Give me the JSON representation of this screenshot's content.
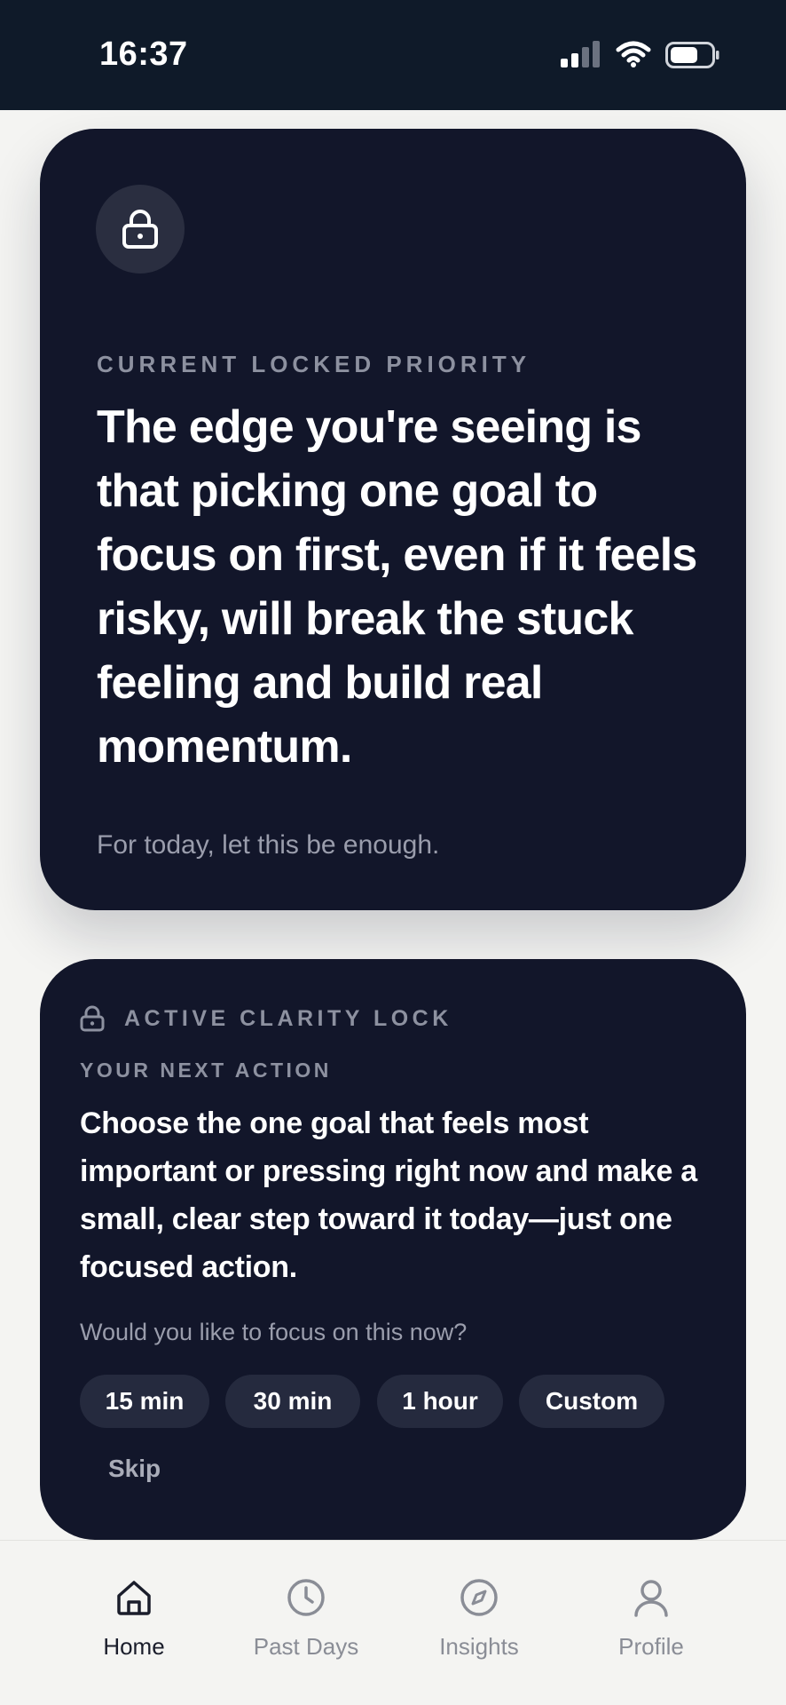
{
  "status_bar": {
    "time": "16:37",
    "icons": [
      "signal-icon",
      "wifi-icon",
      "battery-icon"
    ]
  },
  "priority_card": {
    "icon": "lock-icon",
    "label": "CURRENT LOCKED PRIORITY",
    "text": "The edge you're seeing is that picking one goal to focus on first, even if it feels risky, will break the stuck feeling and build real momentum.",
    "subtext": "For today, let this be enough."
  },
  "action_card": {
    "icon": "lock-icon",
    "active_label": "ACTIVE CLARITY LOCK",
    "next_label": "YOUR NEXT ACTION",
    "next_text": "Choose the one goal that feels most important or pressing right now and make a small, clear step toward it today—just one focused action.",
    "question": "Would you like to focus on this now?",
    "options": [
      "15 min",
      "30 min",
      "1 hour",
      "Custom"
    ],
    "skip": "Skip"
  },
  "tab_bar": {
    "items": [
      {
        "label": "Home",
        "icon": "home-icon",
        "active": true
      },
      {
        "label": "Past Days",
        "icon": "clock-icon",
        "active": false
      },
      {
        "label": "Insights",
        "icon": "compass-icon",
        "active": false
      },
      {
        "label": "Profile",
        "icon": "person-icon",
        "active": false
      }
    ]
  },
  "colors": {
    "status_bar_bg": "#0f1a29",
    "card_bg": "#12162a",
    "chip_bg": "#252a3e",
    "page_bg": "#f4f4f2",
    "muted_text": "#8d91a0"
  }
}
